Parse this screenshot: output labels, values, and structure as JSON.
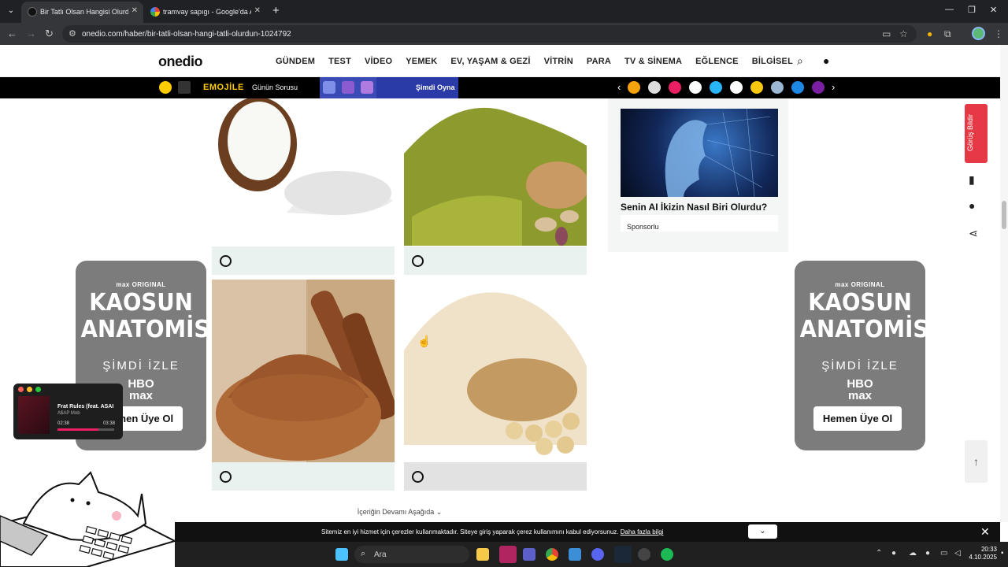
{
  "browser": {
    "tabs": [
      {
        "title": "Bir Tatlı Olsan Hangisi Olurdun?",
        "active": true
      },
      {
        "title": "tramvay sapıgı - Google'da Ara",
        "active": false
      }
    ],
    "url": "onedio.com/haber/bir-tatli-olsan-hangi-tatli-olurdun-1024792"
  },
  "site": {
    "logo": "onedio",
    "menu": [
      "GÜNDEM",
      "TEST",
      "VİDEO",
      "YEMEK",
      "EV, YAŞAM & GEZİ",
      "VİTRİN",
      "PARA",
      "TV & SİNEMA",
      "EĞLENCE",
      "BİLGİSEL"
    ]
  },
  "promo_strip": {
    "emojile": "EMOJİLE",
    "gunun_sorusu": "Günün Sorusu",
    "simdi_oyna": "Şimdi Oyna"
  },
  "sidebar_ad": {
    "title": "Senin AI İkizin Nasıl Biri Olurdu?",
    "sponsor": "Sponsorlu"
  },
  "side_ads": {
    "brand": "max ORIGINAL",
    "title_line1": "KAOSUN",
    "title_line2": "ANATOMİSİ",
    "cta_text": "ŞİMDİ İZLE",
    "logo_line1": "HBO",
    "logo_line2": "max",
    "button": "Hemen Üye Ol"
  },
  "side_tools": {
    "feedback": "Görüş Bildir"
  },
  "content": {
    "more_below": "İçeriğin Devamı Aşağıda ⌄"
  },
  "music_player": {
    "title": "Frat Rules (feat. ASAI",
    "artist": "A$AP Mob",
    "elapsed": "02:38",
    "total": "03:38",
    "progress": 0.72
  },
  "cookie_bar": {
    "text": "Sitemiz en iyi hizmet için çerezler kullanmaktadır. Siteye giriş yaparak çerez kullanımını kabul ediyorsunuz.",
    "link": "Daha fazla bilgi"
  },
  "taskbar": {
    "search_label": "Ara",
    "time": "20:33",
    "date": "4.10.2025"
  },
  "colors": {
    "accent_red": "#e63946",
    "promo_blue": "#3b4bb5",
    "ad_gray": "#7c7c7c",
    "option_green": "#e9f2ee"
  }
}
